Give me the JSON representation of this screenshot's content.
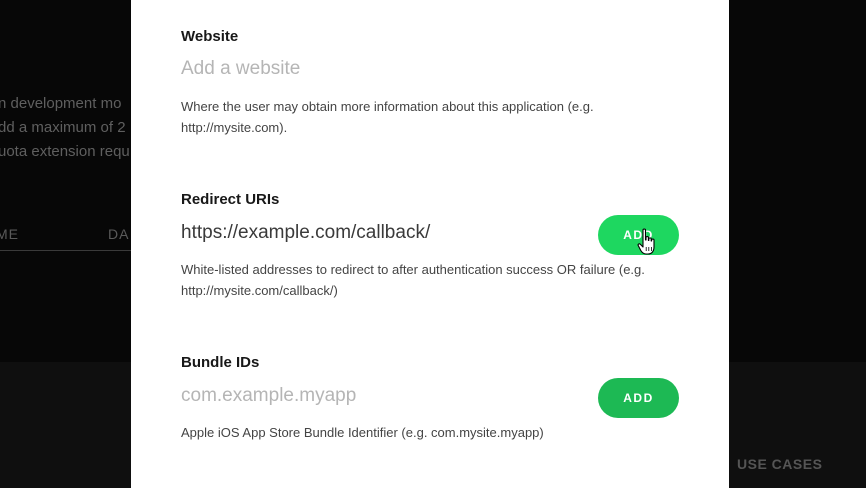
{
  "background": {
    "lines": [
      "n development mo",
      "dd a maximum of 2",
      "uota extension requ"
    ],
    "tabs": [
      "ME",
      "DA"
    ],
    "footer_link": "USE CASES"
  },
  "modal": {
    "website": {
      "label": "Website",
      "placeholder": "Add a website",
      "help": "Where the user may obtain more information about this application (e.g. http://mysite.com)."
    },
    "redirect_uris": {
      "label": "Redirect URIs",
      "value": "https://example.com/callback/",
      "button": "ADD",
      "help": "White-listed addresses to redirect to after authentication success OR failure (e.g. http://mysite.com/callback/)"
    },
    "bundle_ids": {
      "label": "Bundle IDs",
      "placeholder": "com.example.myapp",
      "button": "ADD",
      "help": "Apple iOS App Store Bundle Identifier (e.g. com.mysite.myapp)"
    }
  },
  "colors": {
    "accent": "#1db954",
    "accent_hover": "#1ed760",
    "overlay": "#060606"
  },
  "icons": {
    "cursor": "hand-pointer-icon"
  }
}
